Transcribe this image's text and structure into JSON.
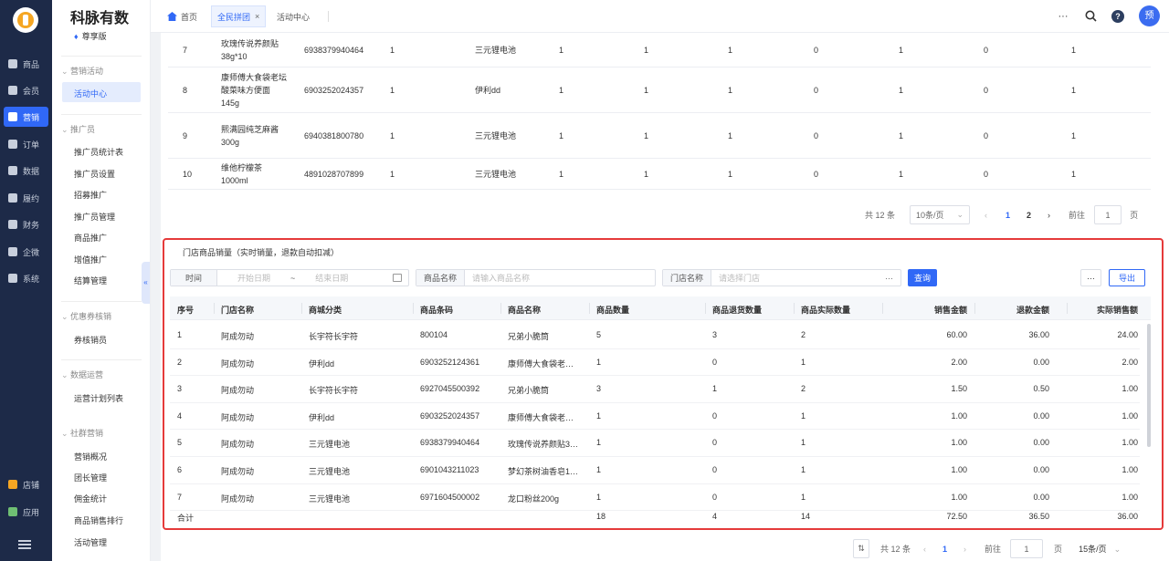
{
  "rail": {
    "items": [
      {
        "label": "商品",
        "icon": "goods-icon"
      },
      {
        "label": "会员",
        "icon": "member-icon"
      },
      {
        "label": "营销",
        "icon": "marketing-icon",
        "active": true
      },
      {
        "label": "订单",
        "icon": "order-icon"
      },
      {
        "label": "数据",
        "icon": "data-icon"
      },
      {
        "label": "履约",
        "icon": "fulfillment-icon"
      },
      {
        "label": "财务",
        "icon": "finance-icon"
      },
      {
        "label": "企微",
        "icon": "wecom-icon"
      },
      {
        "label": "系统",
        "icon": "system-icon"
      }
    ],
    "bottom": [
      {
        "label": "店铺",
        "icon": "store-icon"
      },
      {
        "label": "应用",
        "icon": "apps-icon"
      }
    ]
  },
  "sidebar": {
    "brand": "科脉有数",
    "edition": "尊享版",
    "groups": [
      {
        "title": "营销活动",
        "items": [
          "活动中心"
        ]
      },
      {
        "title": "推广员",
        "items": [
          "推广员统计表",
          "推广员设置",
          "招募推广",
          "推广员管理",
          "商品推广",
          "增值推广",
          "结算管理"
        ]
      },
      {
        "title": "优惠券核销",
        "items": [
          "券核销员"
        ]
      },
      {
        "title": "数据运营",
        "items": [
          "运营计划列表"
        ]
      },
      {
        "title": "社群营销",
        "items": [
          "营销概况",
          "团长管理",
          "佣金统计",
          "商品销售排行",
          "活动管理"
        ]
      }
    ],
    "active_item": "活动中心"
  },
  "topbar": {
    "home": "首页",
    "tabs": [
      {
        "label": "全民拼团",
        "active": true
      },
      {
        "label": "活动中心",
        "active": false
      }
    ]
  },
  "upper_table": {
    "rows": [
      [
        "7",
        "玫瑰传说养颜贴38g*10",
        "6938379940464",
        "1",
        "三元锂电池",
        "1",
        "1",
        "1",
        "0",
        "1",
        "0",
        "1"
      ],
      [
        "8",
        "康师傅大食袋老坛酸菜味方便面145g",
        "6903252024357",
        "1",
        "伊利dd",
        "1",
        "1",
        "1",
        "0",
        "1",
        "0",
        "1"
      ],
      [
        "9",
        "熙满园纯芝麻酱300g",
        "6940381800780",
        "1",
        "三元锂电池",
        "1",
        "1",
        "1",
        "0",
        "1",
        "0",
        "1"
      ],
      [
        "10",
        "维他柠檬茶1000ml",
        "4891028707899",
        "1",
        "三元锂电池",
        "1",
        "1",
        "1",
        "0",
        "1",
        "0",
        "1"
      ]
    ],
    "pagination": {
      "total": "共 12 条",
      "page_size": "10条/页",
      "pages": [
        "1",
        "2"
      ],
      "current": "1",
      "goto_label": "前往",
      "goto_value": "1",
      "page_unit": "页"
    }
  },
  "panel": {
    "title": "门店商品销量（实时销量，退款自动扣减）",
    "filters": {
      "time_label": "时间",
      "start_placeholder": "开始日期",
      "range_sep": "~",
      "end_placeholder": "结束日期",
      "name_label": "商品名称",
      "name_placeholder": "请输入商品名称",
      "store_label": "门店名称",
      "store_placeholder": "请选择门店",
      "query": "查询",
      "more": "···",
      "export": "导出"
    },
    "columns": [
      "序号",
      "门店名称",
      "商城分类",
      "商品条码",
      "商品名称",
      "商品数量",
      "商品退货数量",
      "商品实际数量",
      "销售金额",
      "退款金额",
      "实际销售额"
    ],
    "rows": [
      [
        "1",
        "阿成勿动",
        "长宇符长宇符",
        "800104",
        "兄弟小脆筒",
        "5",
        "3",
        "2",
        "60.00",
        "36.00",
        "24.00"
      ],
      [
        "2",
        "阿成勿动",
        "伊利dd",
        "6903252124361",
        "康师傅大食袋老…",
        "1",
        "0",
        "1",
        "2.00",
        "0.00",
        "2.00"
      ],
      [
        "3",
        "阿成勿动",
        "长宇符长宇符",
        "6927045500392",
        "兄弟小脆筒",
        "3",
        "1",
        "2",
        "1.50",
        "0.50",
        "1.00"
      ],
      [
        "4",
        "阿成勿动",
        "伊利dd",
        "6903252024357",
        "康师傅大食袋老…",
        "1",
        "0",
        "1",
        "1.00",
        "0.00",
        "1.00"
      ],
      [
        "5",
        "阿成勿动",
        "三元锂电池",
        "6938379940464",
        "玫瑰传说养颜贴3…",
        "1",
        "0",
        "1",
        "1.00",
        "0.00",
        "1.00"
      ],
      [
        "6",
        "阿成勿动",
        "三元锂电池",
        "6901043211023",
        "梦幻茶树油香皂1…",
        "1",
        "0",
        "1",
        "1.00",
        "0.00",
        "1.00"
      ],
      [
        "7",
        "阿成勿动",
        "三元锂电池",
        "6971604500002",
        "龙口粉丝200g",
        "1",
        "0",
        "1",
        "1.00",
        "0.00",
        "1.00"
      ]
    ],
    "total": {
      "label": "合计",
      "qty": "18",
      "returns": "4",
      "actual": "14",
      "sales": "72.50",
      "refund": "36.50",
      "net": "36.00"
    }
  },
  "bottom_pagination": {
    "total": "共 12 条",
    "pages": [
      "1"
    ],
    "goto_label": "前往",
    "goto_value": "1",
    "page_unit": "页",
    "page_size": "15条/页"
  }
}
